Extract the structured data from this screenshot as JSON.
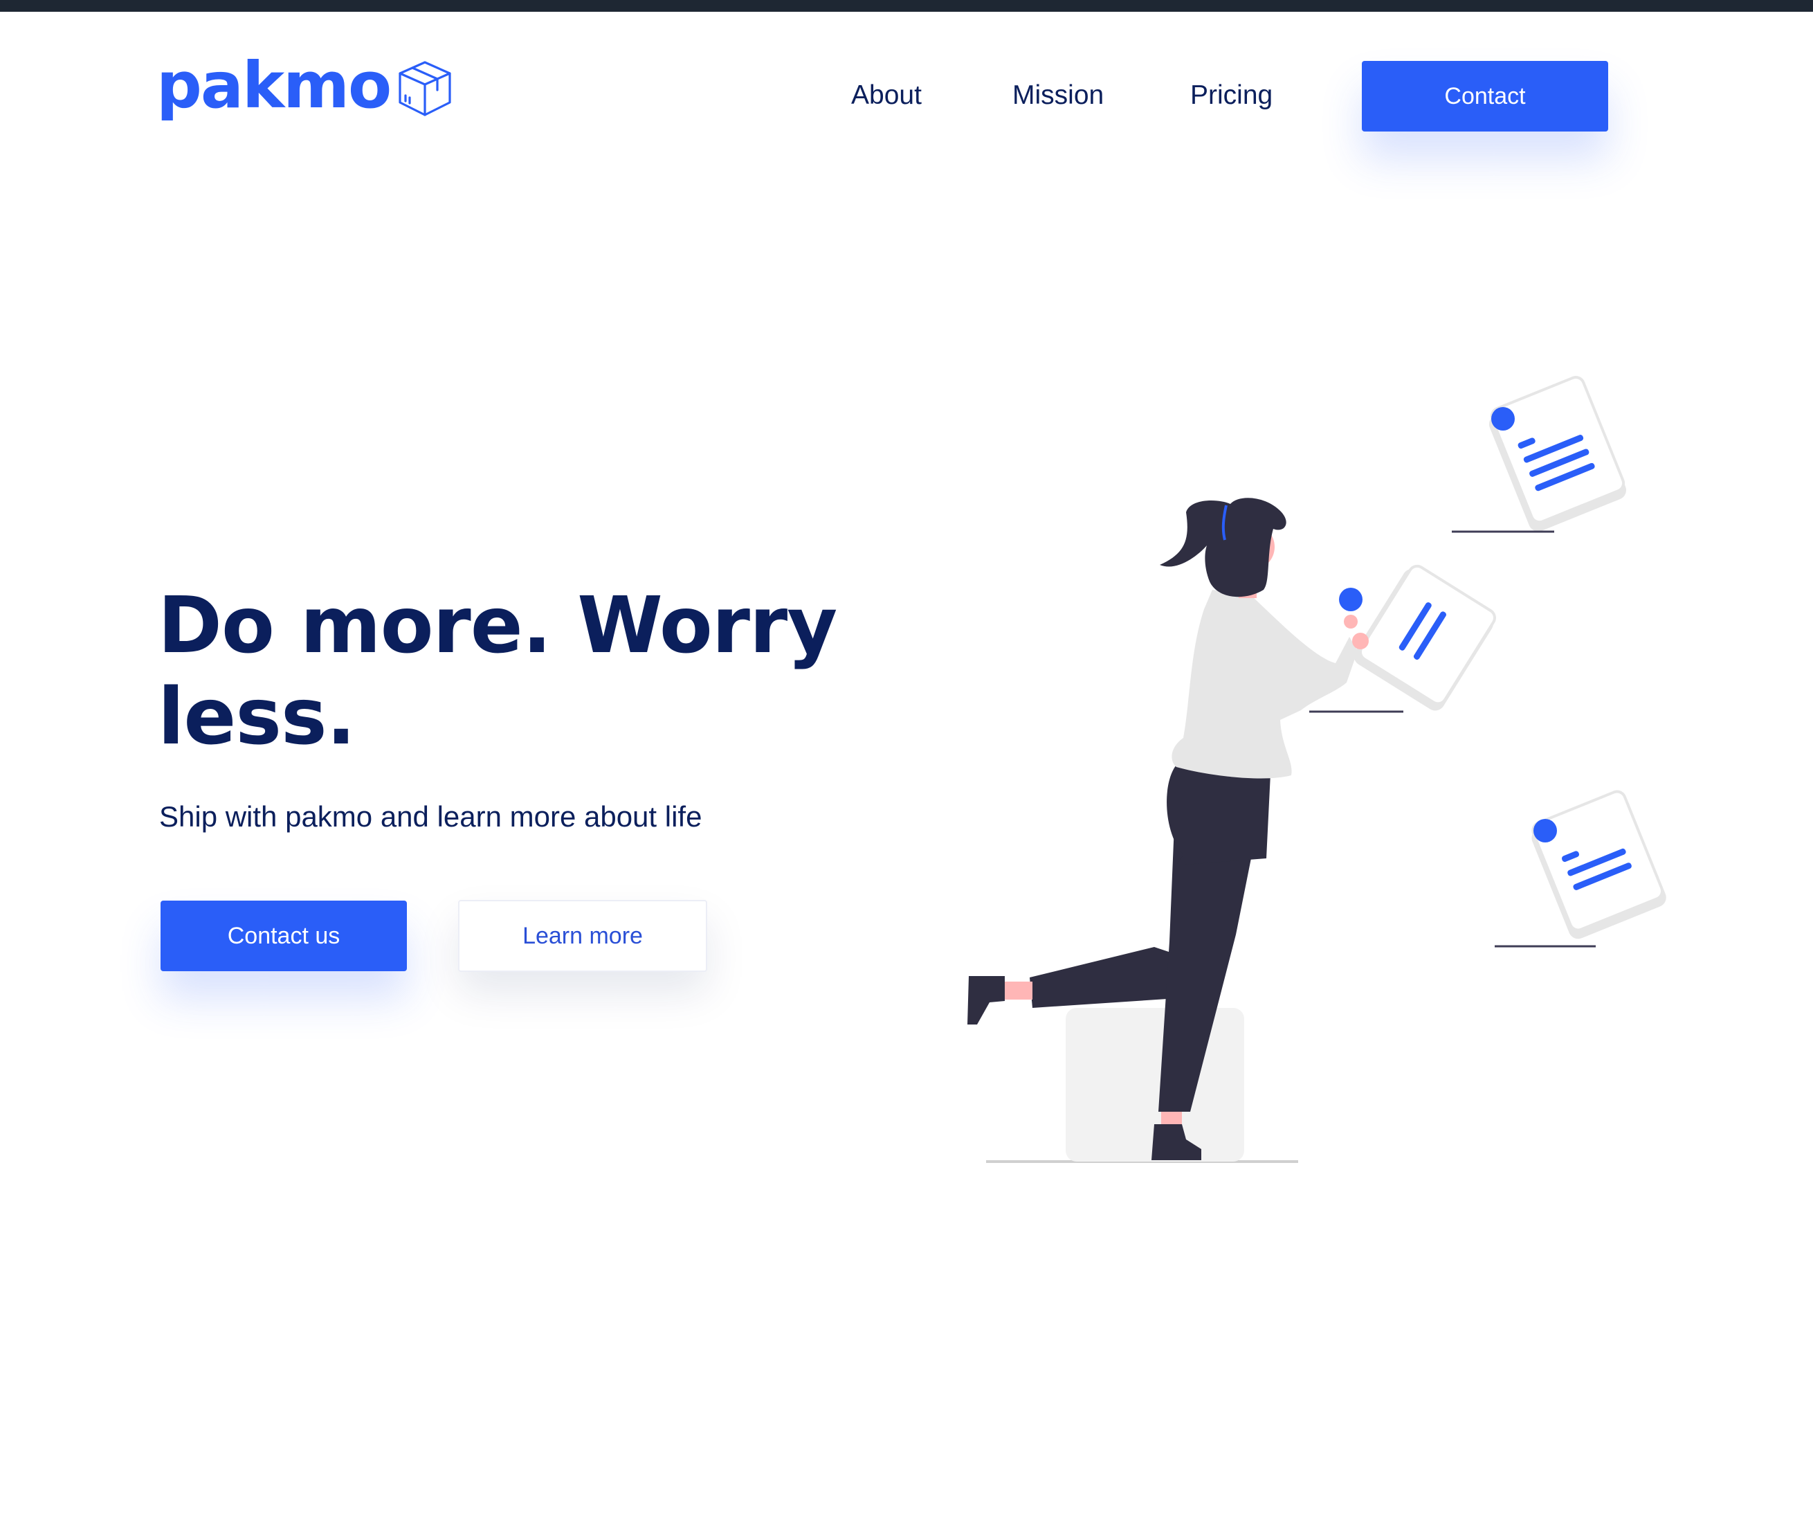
{
  "brand": {
    "name": "pakmo",
    "icon": "package-box-icon",
    "color": "#2a5ef8"
  },
  "nav": {
    "items": [
      {
        "label": "About"
      },
      {
        "label": "Mission"
      },
      {
        "label": "Pricing"
      }
    ],
    "contact_label": "Contact"
  },
  "hero": {
    "title": "Do more. Worry less.",
    "subtitle": "Ship with pakmo and learn more about life",
    "primary_cta": "Contact us",
    "secondary_cta": "Learn more"
  },
  "illustration": {
    "icon": "woman-with-documents-illustration"
  },
  "colors": {
    "accent": "#2a5ef8",
    "text": "#0b1f5c",
    "dark": "#2f2e41",
    "light_grey": "#e6e6e6",
    "skin": "#ffb6b6"
  }
}
